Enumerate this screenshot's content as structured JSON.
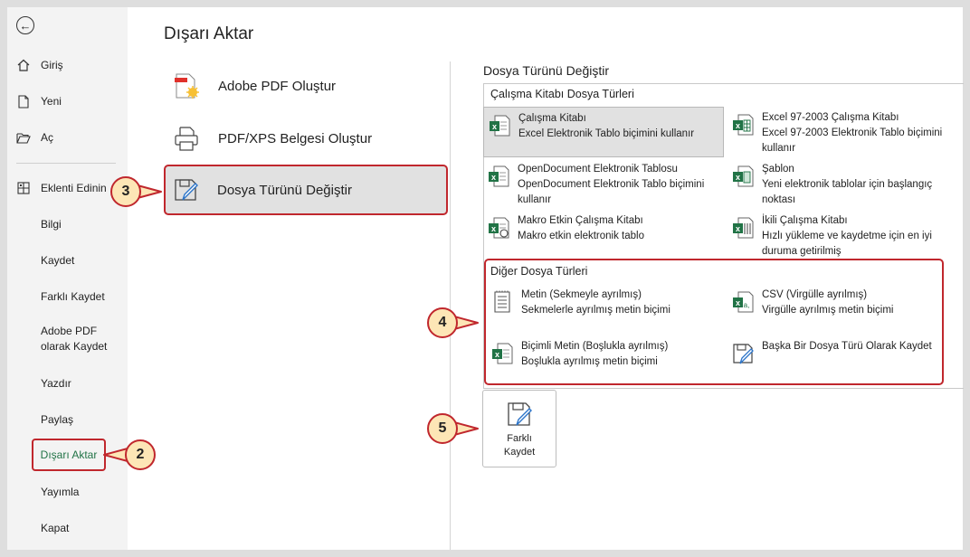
{
  "nav": {
    "back_icon": "back-arrow-icon",
    "items_top": [
      {
        "label": "Giriş",
        "icon": "home-icon"
      },
      {
        "label": "Yeni",
        "icon": "new-file-icon"
      },
      {
        "label": "Aç",
        "icon": "open-folder-icon"
      }
    ],
    "addins": {
      "label": "Eklenti Edinin",
      "icon": "grid-icon"
    },
    "items_plain": [
      "Bilgi",
      "Kaydet",
      "Farklı Kaydet",
      "Adobe PDF olarak Kaydet",
      "Yazdır",
      "Paylaş"
    ],
    "active": "Dışarı Aktar",
    "items_bottom": [
      "Yayımla",
      "Kapat"
    ]
  },
  "middle": {
    "title": "Dışarı Aktar",
    "items": [
      {
        "label": "Adobe PDF Oluştur",
        "icon": "adobe-pdf-icon"
      },
      {
        "label": "PDF/XPS Belgesi Oluştur",
        "icon": "pdf-xps-icon"
      },
      {
        "label": "Dosya Türünü Değiştir",
        "icon": "change-file-type-icon"
      }
    ]
  },
  "right": {
    "section_title": "Dosya Türünü Değiştir",
    "workbook_group": "Çalışma Kitabı Dosya Türleri",
    "workbook_types": [
      {
        "title": "Çalışma Kitabı",
        "desc": "Excel Elektronik Tablo biçimini kullanır",
        "icon": "excel-workbook-icon"
      },
      {
        "title": "Excel 97-2003 Çalışma Kitabı",
        "desc": "Excel 97-2003 Elektronik Tablo biçimini kullanır",
        "icon": "excel-97-icon"
      },
      {
        "title": "OpenDocument Elektronik Tablosu",
        "desc": "OpenDocument Elektronik Tablo biçimini kullanır",
        "icon": "opendocument-icon"
      },
      {
        "title": "Şablon",
        "desc": "Yeni elektronik tablolar için başlangıç noktası",
        "icon": "template-icon"
      },
      {
        "title": "Makro Etkin Çalışma Kitabı",
        "desc": "Makro etkin elektronik tablo",
        "icon": "macro-workbook-icon"
      },
      {
        "title": "İkili Çalışma Kitabı",
        "desc": "Hızlı yükleme ve kaydetme için en iyi duruma getirilmiş",
        "icon": "binary-workbook-icon"
      }
    ],
    "other_group": "Diğer Dosya Türleri",
    "other_types": [
      {
        "title": "Metin (Sekmeyle ayrılmış)",
        "desc": "Sekmelerle ayrılmış metin biçimi",
        "icon": "text-file-icon"
      },
      {
        "title": "CSV (Virgülle ayrılmış)",
        "desc": "Virgülle ayrılmış metin biçimi",
        "icon": "csv-icon"
      },
      {
        "title": "Biçimli Metin (Boşlukla ayrılmış)",
        "desc": "Boşlukla ayrılmış metin biçimi",
        "icon": "formatted-text-icon"
      },
      {
        "title": "Başka Bir Dosya Türü Olarak Kaydet",
        "desc": "",
        "icon": "save-other-icon"
      }
    ],
    "save_as_button": "Farklı Kaydet"
  },
  "callouts": [
    "2",
    "3",
    "4",
    "5"
  ],
  "colors": {
    "accent_red": "#c0272d",
    "callout_fill": "#fde6b6",
    "excel_green": "#217346"
  }
}
